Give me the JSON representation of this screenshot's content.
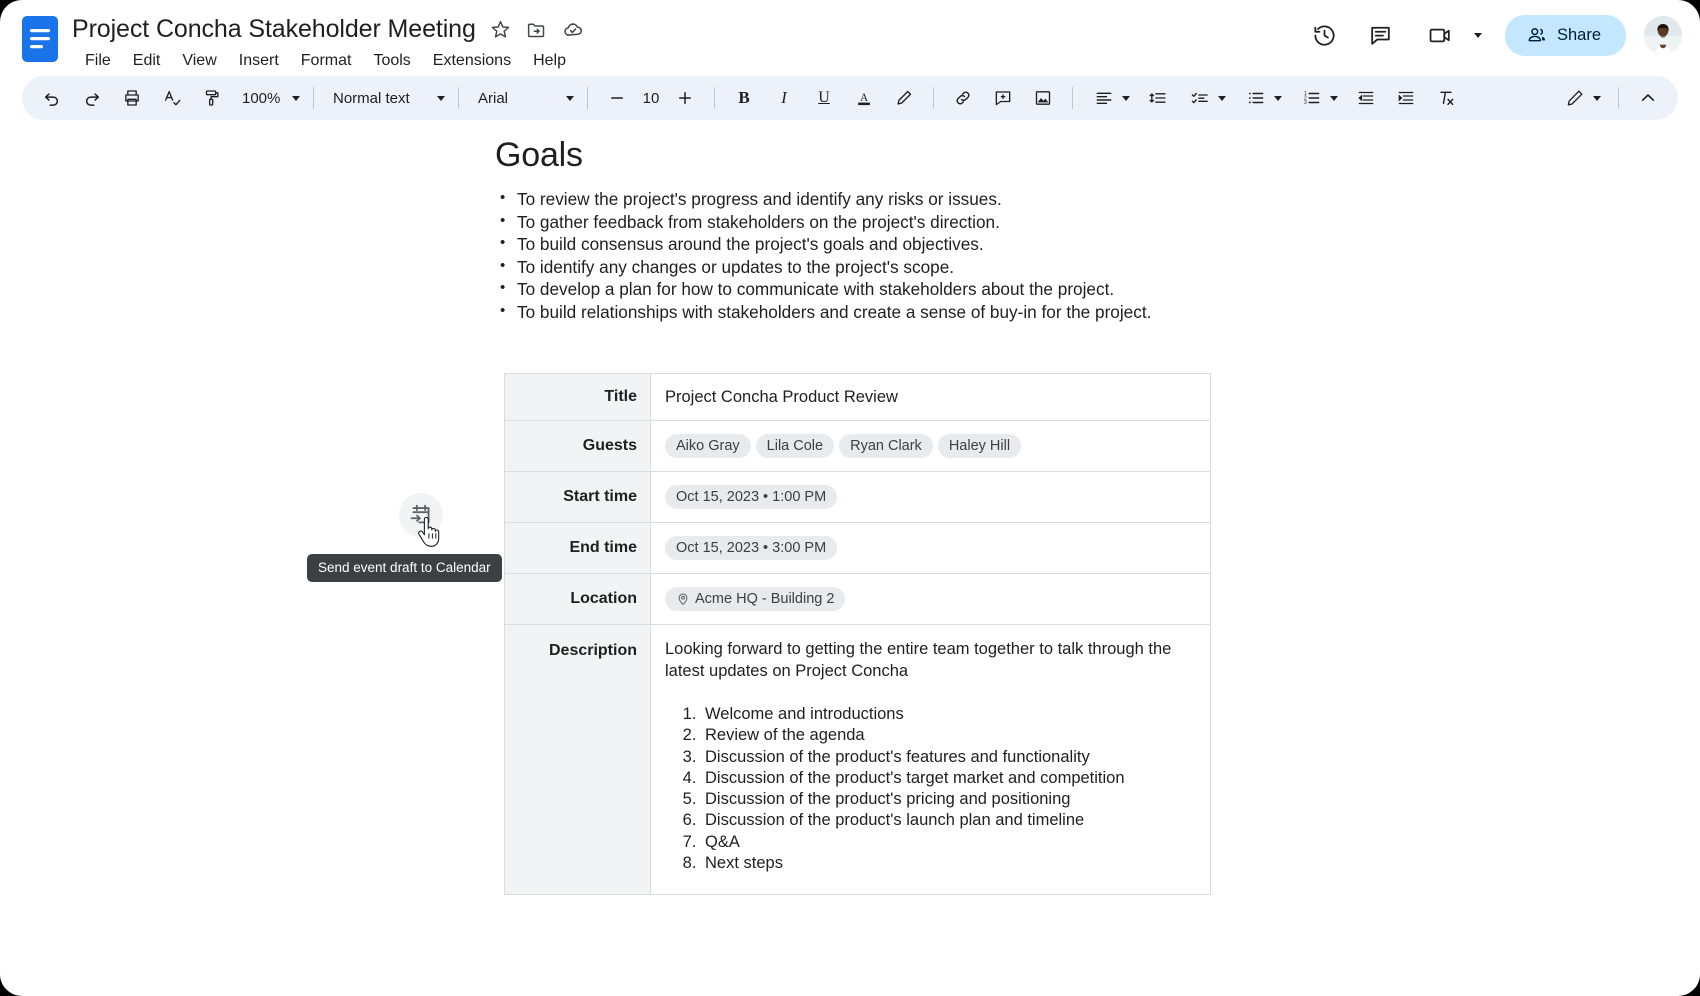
{
  "header": {
    "doc_title": "Project Concha Stakeholder Meeting",
    "logo_icon": "google-docs-logo",
    "title_icons": [
      {
        "name": "star-icon",
        "label": "Star"
      },
      {
        "name": "move-to-folder-icon",
        "label": "Move"
      },
      {
        "name": "cloud-saved-icon",
        "label": "Saved to Drive"
      }
    ],
    "menu": [
      "File",
      "Edit",
      "View",
      "Insert",
      "Format",
      "Tools",
      "Extensions",
      "Help"
    ],
    "right_icons": [
      {
        "name": "version-history-icon",
        "label": "Version history"
      },
      {
        "name": "comment-history-icon",
        "label": "Open comment history"
      },
      {
        "name": "meet-icon",
        "label": "Join a call here or present this tab to the call"
      }
    ],
    "share_label": "Share",
    "share_icon": "people-icon",
    "share_bg": "#c2e7ff",
    "avatar_name": "account-avatar"
  },
  "toolbar": {
    "zoom_value": "100%",
    "style_value": "Normal text",
    "font_value": "Arial",
    "font_size": "10",
    "buttons": [
      {
        "name": "undo-icon",
        "label": "Undo"
      },
      {
        "name": "redo-icon",
        "label": "Redo"
      },
      {
        "name": "print-icon",
        "label": "Print"
      },
      {
        "name": "spellcheck-icon",
        "label": "Spelling and grammar check"
      },
      {
        "name": "paint-format-icon",
        "label": "Paint format"
      },
      {
        "name": "decrease-font-size-icon",
        "label": "Decrease font size"
      },
      {
        "name": "increase-font-size-icon",
        "label": "Increase font size"
      },
      {
        "name": "bold-icon",
        "label": "Bold"
      },
      {
        "name": "italic-icon",
        "label": "Italic"
      },
      {
        "name": "underline-icon",
        "label": "Underline"
      },
      {
        "name": "text-color-icon",
        "label": "Text color"
      },
      {
        "name": "highlight-color-icon",
        "label": "Highlight color"
      },
      {
        "name": "insert-link-icon",
        "label": "Insert link"
      },
      {
        "name": "add-comment-icon",
        "label": "Add comment"
      },
      {
        "name": "insert-image-icon",
        "label": "Insert image"
      },
      {
        "name": "align-icon",
        "label": "Align"
      },
      {
        "name": "line-spacing-icon",
        "label": "Line & paragraph spacing"
      },
      {
        "name": "checklist-icon",
        "label": "Checklist"
      },
      {
        "name": "bulleted-list-icon",
        "label": "Bulleted list"
      },
      {
        "name": "numbered-list-icon",
        "label": "Numbered list"
      },
      {
        "name": "decrease-indent-icon",
        "label": "Decrease indent"
      },
      {
        "name": "increase-indent-icon",
        "label": "Increase indent"
      },
      {
        "name": "clear-formatting-icon",
        "label": "Clear formatting"
      },
      {
        "name": "editing-mode-icon",
        "label": "Editing mode"
      },
      {
        "name": "hide-menus-icon",
        "label": "Hide the menus"
      }
    ]
  },
  "document": {
    "heading": "Goals",
    "bullets": [
      "To review the project's progress and identify any risks or issues.",
      "To gather feedback from stakeholders on the project's direction.",
      "To build consensus around the project's goals and objectives.",
      "To identify any changes or updates to the project's scope.",
      "To develop a plan for how to communicate with stakeholders about the project.",
      "To build relationships with stakeholders and create a sense of buy-in for the project."
    ],
    "event_table": {
      "rows": [
        {
          "label": "Title",
          "type": "text",
          "value": "Project Concha Product Review"
        },
        {
          "label": "Guests",
          "type": "chips",
          "values": [
            "Aiko Gray",
            "Lila Cole",
            "Ryan Clark",
            "Haley Hill"
          ]
        },
        {
          "label": "Start time",
          "type": "chip",
          "value": "Oct 15, 2023 • 1:00 PM"
        },
        {
          "label": "End time",
          "type": "chip",
          "value": "Oct 15, 2023 • 3:00 PM"
        },
        {
          "label": "Location",
          "type": "chip-icon",
          "icon": "location-pin-icon",
          "value": "Acme HQ - Building 2"
        },
        {
          "label": "Description",
          "type": "rich"
        }
      ],
      "description_text": "Looking forward to getting the entire team together to talk through the latest updates on Project Concha",
      "agenda": [
        "Welcome and introductions",
        "Review of the agenda",
        "Discussion of the product's features and functionality",
        "Discussion of the product's target market and competition",
        "Discussion of the product's pricing and positioning",
        "Discussion of the product's launch plan and timeline",
        "Q&A",
        "Next steps"
      ]
    }
  },
  "overlay": {
    "calendar_button_icon": "send-event-to-calendar-icon",
    "tooltip_text": "Send event draft to Calendar",
    "cursor": "pointer-hand-cursor"
  }
}
